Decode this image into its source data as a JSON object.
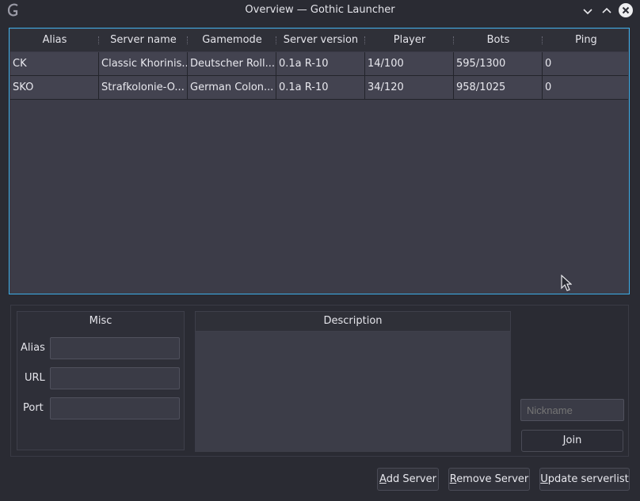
{
  "window": {
    "title": "Overview — Gothic Launcher",
    "app_icon": "gothic-g-icon",
    "controls": [
      "minimize-icon",
      "maximize-icon",
      "close-icon"
    ]
  },
  "server_table": {
    "columns": [
      "Alias",
      "Server name",
      "Gamemode",
      "Server version",
      "Player",
      "Bots",
      "Ping"
    ],
    "rows": [
      [
        "CK",
        "Classic Khorinis...",
        "Deutscher Roll...",
        "0.1a R-10",
        "14/100",
        "595/1300",
        "0"
      ],
      [
        "SKO",
        "Strafkolonie-O...",
        "German Colon...",
        "0.1a R-10",
        "34/120",
        "958/1025",
        "0"
      ]
    ]
  },
  "misc": {
    "title": "Misc",
    "alias_label": "Alias",
    "alias_value": "",
    "url_label": "URL",
    "url_value": "",
    "port_label": "Port",
    "port_value": ""
  },
  "description": {
    "header": "Description",
    "text": ""
  },
  "join": {
    "nickname_placeholder": "Nickname",
    "join_label_prefix": "",
    "join_label_mnemonic": "J",
    "join_label_rest": "oin"
  },
  "footer": {
    "add_mnemonic": "A",
    "add_rest": "dd Server",
    "remove_mnemonic": "R",
    "remove_rest": "emove Server",
    "update_mnemonic": "U",
    "update_rest": "pdate serverlist"
  },
  "colors": {
    "focus_border": "#3daee9",
    "background": "#2a2b33",
    "row_bg": "#434350"
  }
}
